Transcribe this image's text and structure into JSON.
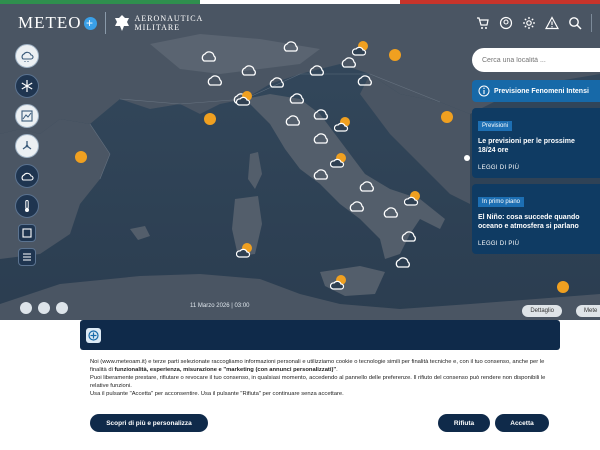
{
  "header": {
    "logo_text": "METEO",
    "logo_plus": "+",
    "am_line1": "AERONAUTICA",
    "am_line2": "MILITARE"
  },
  "header_icons": [
    "cart-icon",
    "account-icon",
    "gear-icon",
    "warning-icon",
    "search-icon"
  ],
  "colors": {
    "flag_green": "#2f8f4e",
    "flag_white": "#ffffff",
    "flag_red": "#c8342b",
    "navy": "#0f2a4a",
    "panel_blue": "#0f3b63",
    "accent_blue": "#1769a8"
  },
  "sidebar": {
    "items": [
      {
        "icon": "cloud-icon"
      },
      {
        "icon": "snowflake-icon"
      },
      {
        "icon": "satellite-image-icon"
      },
      {
        "icon": "wind-icon"
      },
      {
        "icon": "cloud-outline-icon"
      },
      {
        "icon": "thermometer-icon"
      },
      {
        "icon": "layers-icon"
      },
      {
        "icon": "list-icon"
      }
    ]
  },
  "search": {
    "placeholder": "Cerca una località ..."
  },
  "panel": {
    "alert_title": "Previsione Fenomeni Intensi",
    "news": [
      {
        "badge": "Previsioni",
        "title": "Le previsioni per le prossime 18/24 ore",
        "link": "LEGGI DI PIÙ"
      },
      {
        "badge": "In primo piano",
        "title": "El Niño: cosa succede quando oceano e atmosfera si parlano",
        "link": "LEGGI DI PIÙ"
      }
    ]
  },
  "timebar": {
    "label": "11 Marzo 2026 | 03:00"
  },
  "attribution": {
    "text1": "Dettaglio",
    "text2": "Mete"
  },
  "cookie": {
    "para1_start": "Noi (www.meteoam.it) e terze parti selezionate raccogliamo informazioni personali e utilizziamo cookie o tecnologie simili per finalità tecniche e, con il tuo consenso, anche per le finalità di ",
    "para1_bold": "funzionalità, esperienza, misurazione e \"marketing (con annunci personalizzati)\"",
    "para1_end": ".",
    "para2": "Puoi liberamente prestare, rifiutare o revocare il tuo consenso, in qualsiasi momento, accedendo al pannello delle preferenze. Il rifiuto del consenso può rendere non disponibili le relative funzioni.",
    "para3": "Usa il pulsante \"Accetta\" per acconsentire. Usa il pulsante \"Rifiuta\" per continuare senza accettare.",
    "btn_more": "Scopri di più e personalizza",
    "btn_reject": "Rifiuta",
    "btn_accept": "Accetta"
  }
}
